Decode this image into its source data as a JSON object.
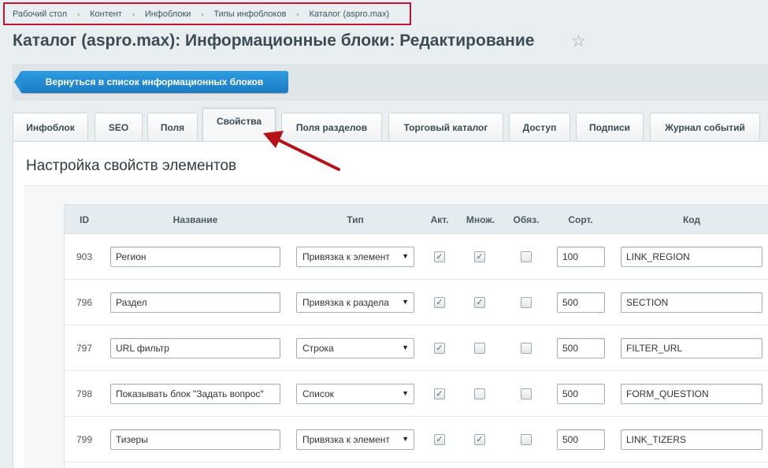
{
  "breadcrumb": {
    "items": [
      "Рабочий стол",
      "Контент",
      "Инфоблоки",
      "Типы инфоблоков",
      "Каталог (aspro.max)"
    ],
    "separator": "›"
  },
  "page": {
    "title": "Каталог (aspro.max): Информационные блоки: Редактирование",
    "star_icon": "☆",
    "back_label": "Вернуться в список информационных блоков"
  },
  "tabs": [
    {
      "label": "Инфоблок"
    },
    {
      "label": "SEO"
    },
    {
      "label": "Поля"
    },
    {
      "label": "Свойства",
      "active": true
    },
    {
      "label": "Поля разделов"
    },
    {
      "label": "Торговый каталог"
    },
    {
      "label": "Доступ"
    },
    {
      "label": "Подписи"
    },
    {
      "label": "Журнал событий"
    }
  ],
  "section": {
    "title": "Настройка свойств элементов"
  },
  "table": {
    "columns": {
      "id": "ID",
      "name": "Название",
      "type": "Тип",
      "active": "Акт.",
      "multiple": "Множ.",
      "required": "Обяз.",
      "sort": "Сорт.",
      "code": "Код"
    },
    "rows": [
      {
        "id": "903",
        "name": "Регион",
        "type": "Привязка к элемент",
        "active": true,
        "multiple": true,
        "required": false,
        "sort": "100",
        "code": "LINK_REGION"
      },
      {
        "id": "796",
        "name": "Раздел",
        "type": "Привязка к раздела",
        "active": true,
        "multiple": true,
        "required": false,
        "sort": "500",
        "code": "SECTION"
      },
      {
        "id": "797",
        "name": "URL фильтр",
        "type": "Строка",
        "active": true,
        "multiple": false,
        "required": false,
        "sort": "500",
        "code": "FILTER_URL"
      },
      {
        "id": "798",
        "name": "Показывать блок \"Задать вопрос\"",
        "type": "Список",
        "active": true,
        "multiple": false,
        "required": false,
        "sort": "500",
        "code": "FORM_QUESTION"
      },
      {
        "id": "799",
        "name": "Тизеры",
        "type": "Привязка к элемент",
        "active": true,
        "multiple": true,
        "required": false,
        "sort": "500",
        "code": "LINK_TIZERS"
      }
    ],
    "check_glyph": "✓",
    "select_arrow": "▼"
  },
  "colors": {
    "accent": "#c41230",
    "button": "#1c7cc2"
  }
}
